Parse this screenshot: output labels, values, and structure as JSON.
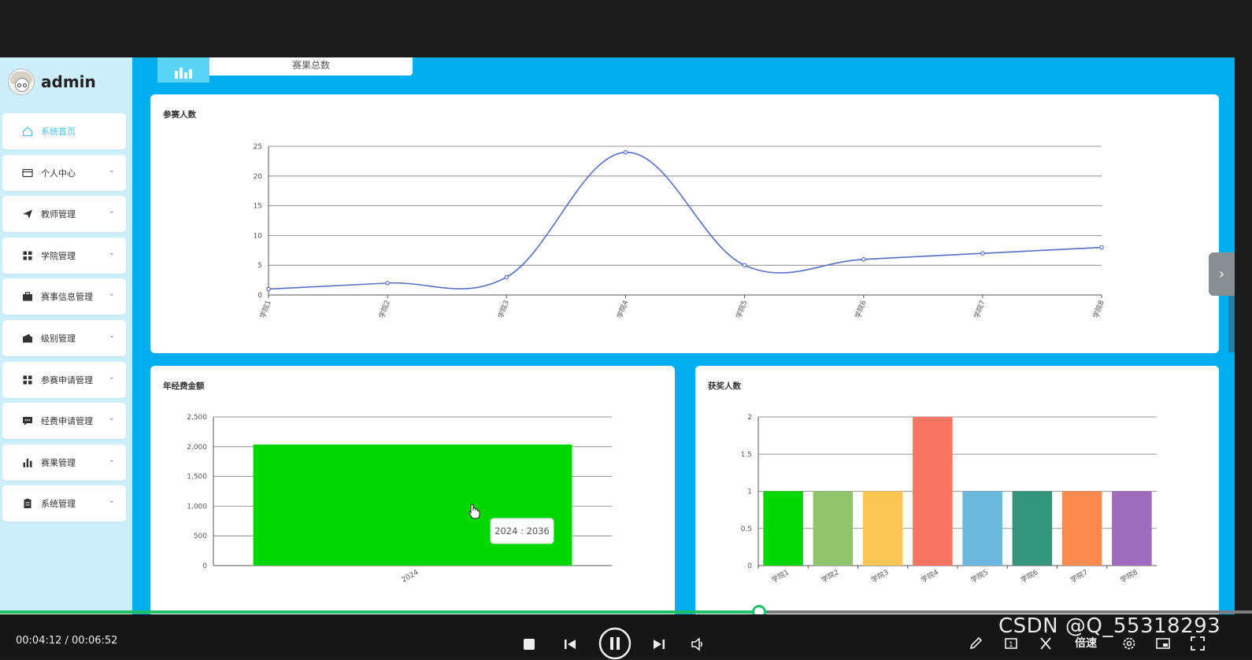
{
  "sidebar": {
    "brand": {
      "name": "admin"
    },
    "items": [
      {
        "label": "系统首页",
        "icon": "home-icon",
        "active": true,
        "has_children": false
      },
      {
        "label": "个人中心",
        "icon": "id-card-icon",
        "active": false,
        "has_children": true
      },
      {
        "label": "教师管理",
        "icon": "paper-plane-icon",
        "active": false,
        "has_children": true
      },
      {
        "label": "学院管理",
        "icon": "grid-icon",
        "active": false,
        "has_children": true
      },
      {
        "label": "赛事信息管理",
        "icon": "briefcase-icon",
        "active": false,
        "has_children": true
      },
      {
        "label": "级别管理",
        "icon": "wallet-icon",
        "active": false,
        "has_children": true
      },
      {
        "label": "参赛申请管理",
        "icon": "grid-icon",
        "active": false,
        "has_children": true
      },
      {
        "label": "经费申请管理",
        "icon": "message-icon",
        "active": false,
        "has_children": true
      },
      {
        "label": "赛果管理",
        "icon": "bar-chart-icon",
        "active": false,
        "has_children": true
      },
      {
        "label": "系统管理",
        "icon": "clipboard-icon",
        "active": false,
        "has_children": true
      }
    ]
  },
  "stat_card": {
    "label": "赛果总数",
    "icon": "bar-chart-icon"
  },
  "chart_data": [
    {
      "type": "line",
      "title": "参赛人数",
      "categories": [
        "学院1",
        "学院2",
        "学院3",
        "学院4",
        "学院5",
        "学院6",
        "学院7",
        "学院8"
      ],
      "values": [
        1,
        2,
        3,
        24,
        5,
        6,
        7,
        8
      ],
      "ylim": [
        0,
        25
      ],
      "yticks": [
        "0",
        "5",
        "10",
        "15",
        "20",
        "25"
      ],
      "grid": true,
      "color": "#5470c6",
      "smooth": true
    },
    {
      "type": "bar",
      "title": "年经费金额",
      "categories": [
        "2024"
      ],
      "values": [
        2036
      ],
      "ylim": [
        0,
        2500
      ],
      "yticks": [
        "0",
        "500",
        "1,000",
        "1,500",
        "2,000",
        "2,500"
      ],
      "grid": true,
      "color": "#00d800",
      "tooltip": "2024 : 2036"
    },
    {
      "type": "bar",
      "title": "获奖人数",
      "categories": [
        "学院1",
        "学院2",
        "学院3",
        "学院4",
        "学院5",
        "学院6",
        "学院7",
        "学院8"
      ],
      "values": [
        1,
        1,
        1,
        2,
        1,
        1,
        1,
        1
      ],
      "ylim": [
        0,
        2
      ],
      "yticks": [
        "0",
        "0.5",
        "1",
        "1.5",
        "2"
      ],
      "grid": true,
      "colors": [
        "#00d800",
        "#91c46c",
        "#fcc654",
        "#fb7564",
        "#6ab8dd",
        "#33967a",
        "#fd8a4e",
        "#9d6dbb"
      ]
    }
  ],
  "player": {
    "time": "00:04:12 / 00:06:52",
    "progress": 0.606,
    "speed_label": "倍速",
    "watermark": "CSDN @Q_55318293"
  }
}
